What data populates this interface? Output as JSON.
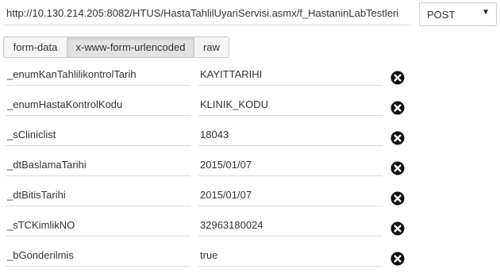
{
  "request": {
    "url": "http://10.130.214.205:8082/HTUS/HastaTahlilUyariServisi.asmx/f_HastaninLabTestleri",
    "method": "POST"
  },
  "body_tabs": [
    {
      "label": "form-data",
      "active": false
    },
    {
      "label": "x-www-form-urlencoded",
      "active": true
    },
    {
      "label": "raw",
      "active": false
    }
  ],
  "params": [
    {
      "key": "_enumKanTahlilikontrolTarih",
      "value": "KAYITTARIHI"
    },
    {
      "key": "_enumHastaKontrolKodu",
      "value": "KLINIK_KODU"
    },
    {
      "key": "_sCliniclist",
      "value": "18043"
    },
    {
      "key": "_dtBaslamaTarihi",
      "value": "2015/01/07"
    },
    {
      "key": "_dtBitisTarihi",
      "value": "2015/01/07"
    },
    {
      "key": "_sTCKimlikNO",
      "value": "32963180024"
    },
    {
      "key": "_bGonderilmis",
      "value": "true"
    }
  ],
  "icons": {
    "delete": "close-circle-icon",
    "dropdown": "chevron-down-icon"
  },
  "colors": {
    "border": "#dcdcdc",
    "tab_active_bg": "#e2e2e2",
    "tab_bg": "#f5f5f5",
    "delete_icon": "#111111"
  }
}
